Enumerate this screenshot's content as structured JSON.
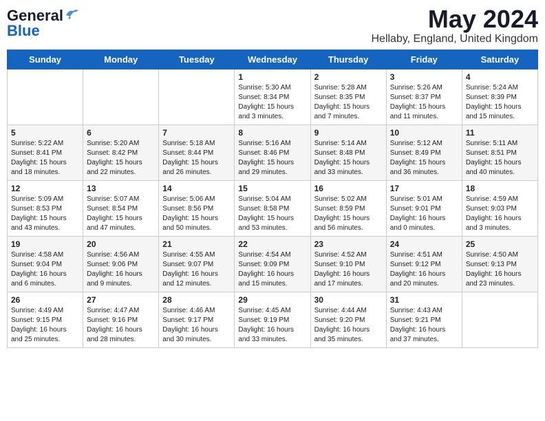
{
  "header": {
    "logo_general": "General",
    "logo_blue": "Blue",
    "title": "May 2024",
    "location": "Hellaby, England, United Kingdom"
  },
  "days_of_week": [
    "Sunday",
    "Monday",
    "Tuesday",
    "Wednesday",
    "Thursday",
    "Friday",
    "Saturday"
  ],
  "weeks": [
    [
      {
        "day": "",
        "info": ""
      },
      {
        "day": "",
        "info": ""
      },
      {
        "day": "",
        "info": ""
      },
      {
        "day": "1",
        "info": "Sunrise: 5:30 AM\nSunset: 8:34 PM\nDaylight: 15 hours\nand 3 minutes."
      },
      {
        "day": "2",
        "info": "Sunrise: 5:28 AM\nSunset: 8:35 PM\nDaylight: 15 hours\nand 7 minutes."
      },
      {
        "day": "3",
        "info": "Sunrise: 5:26 AM\nSunset: 8:37 PM\nDaylight: 15 hours\nand 11 minutes."
      },
      {
        "day": "4",
        "info": "Sunrise: 5:24 AM\nSunset: 8:39 PM\nDaylight: 15 hours\nand 15 minutes."
      }
    ],
    [
      {
        "day": "5",
        "info": "Sunrise: 5:22 AM\nSunset: 8:41 PM\nDaylight: 15 hours\nand 18 minutes."
      },
      {
        "day": "6",
        "info": "Sunrise: 5:20 AM\nSunset: 8:42 PM\nDaylight: 15 hours\nand 22 minutes."
      },
      {
        "day": "7",
        "info": "Sunrise: 5:18 AM\nSunset: 8:44 PM\nDaylight: 15 hours\nand 26 minutes."
      },
      {
        "day": "8",
        "info": "Sunrise: 5:16 AM\nSunset: 8:46 PM\nDaylight: 15 hours\nand 29 minutes."
      },
      {
        "day": "9",
        "info": "Sunrise: 5:14 AM\nSunset: 8:48 PM\nDaylight: 15 hours\nand 33 minutes."
      },
      {
        "day": "10",
        "info": "Sunrise: 5:12 AM\nSunset: 8:49 PM\nDaylight: 15 hours\nand 36 minutes."
      },
      {
        "day": "11",
        "info": "Sunrise: 5:11 AM\nSunset: 8:51 PM\nDaylight: 15 hours\nand 40 minutes."
      }
    ],
    [
      {
        "day": "12",
        "info": "Sunrise: 5:09 AM\nSunset: 8:53 PM\nDaylight: 15 hours\nand 43 minutes."
      },
      {
        "day": "13",
        "info": "Sunrise: 5:07 AM\nSunset: 8:54 PM\nDaylight: 15 hours\nand 47 minutes."
      },
      {
        "day": "14",
        "info": "Sunrise: 5:06 AM\nSunset: 8:56 PM\nDaylight: 15 hours\nand 50 minutes."
      },
      {
        "day": "15",
        "info": "Sunrise: 5:04 AM\nSunset: 8:58 PM\nDaylight: 15 hours\nand 53 minutes."
      },
      {
        "day": "16",
        "info": "Sunrise: 5:02 AM\nSunset: 8:59 PM\nDaylight: 15 hours\nand 56 minutes."
      },
      {
        "day": "17",
        "info": "Sunrise: 5:01 AM\nSunset: 9:01 PM\nDaylight: 16 hours\nand 0 minutes."
      },
      {
        "day": "18",
        "info": "Sunrise: 4:59 AM\nSunset: 9:03 PM\nDaylight: 16 hours\nand 3 minutes."
      }
    ],
    [
      {
        "day": "19",
        "info": "Sunrise: 4:58 AM\nSunset: 9:04 PM\nDaylight: 16 hours\nand 6 minutes."
      },
      {
        "day": "20",
        "info": "Sunrise: 4:56 AM\nSunset: 9:06 PM\nDaylight: 16 hours\nand 9 minutes."
      },
      {
        "day": "21",
        "info": "Sunrise: 4:55 AM\nSunset: 9:07 PM\nDaylight: 16 hours\nand 12 minutes."
      },
      {
        "day": "22",
        "info": "Sunrise: 4:54 AM\nSunset: 9:09 PM\nDaylight: 16 hours\nand 15 minutes."
      },
      {
        "day": "23",
        "info": "Sunrise: 4:52 AM\nSunset: 9:10 PM\nDaylight: 16 hours\nand 17 minutes."
      },
      {
        "day": "24",
        "info": "Sunrise: 4:51 AM\nSunset: 9:12 PM\nDaylight: 16 hours\nand 20 minutes."
      },
      {
        "day": "25",
        "info": "Sunrise: 4:50 AM\nSunset: 9:13 PM\nDaylight: 16 hours\nand 23 minutes."
      }
    ],
    [
      {
        "day": "26",
        "info": "Sunrise: 4:49 AM\nSunset: 9:15 PM\nDaylight: 16 hours\nand 25 minutes."
      },
      {
        "day": "27",
        "info": "Sunrise: 4:47 AM\nSunset: 9:16 PM\nDaylight: 16 hours\nand 28 minutes."
      },
      {
        "day": "28",
        "info": "Sunrise: 4:46 AM\nSunset: 9:17 PM\nDaylight: 16 hours\nand 30 minutes."
      },
      {
        "day": "29",
        "info": "Sunrise: 4:45 AM\nSunset: 9:19 PM\nDaylight: 16 hours\nand 33 minutes."
      },
      {
        "day": "30",
        "info": "Sunrise: 4:44 AM\nSunset: 9:20 PM\nDaylight: 16 hours\nand 35 minutes."
      },
      {
        "day": "31",
        "info": "Sunrise: 4:43 AM\nSunset: 9:21 PM\nDaylight: 16 hours\nand 37 minutes."
      },
      {
        "day": "",
        "info": ""
      }
    ]
  ]
}
